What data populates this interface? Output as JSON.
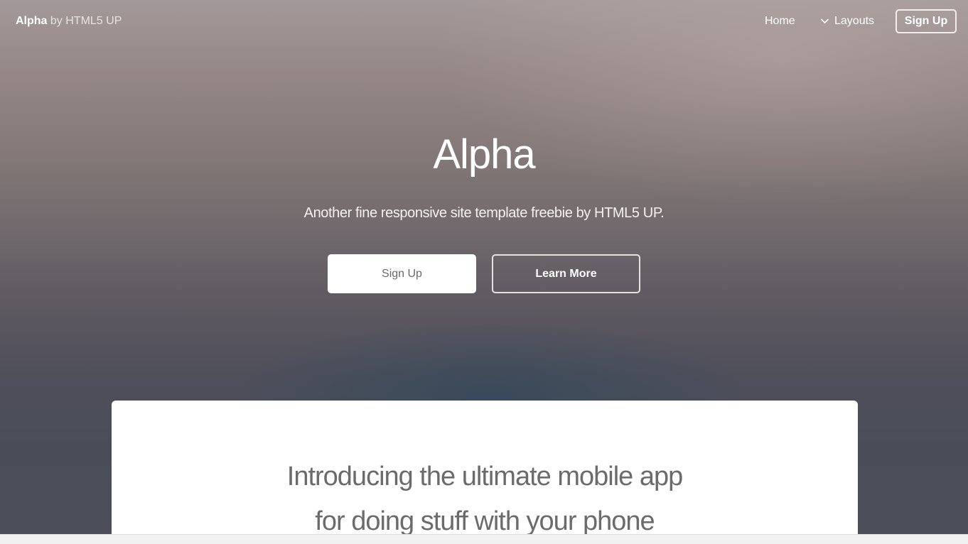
{
  "header": {
    "brand_name": "Alpha",
    "brand_suffix": "by HTML5 UP",
    "nav": {
      "home": "Home",
      "layouts": "Layouts",
      "signup": "Sign Up"
    }
  },
  "hero": {
    "title": "Alpha",
    "subtitle": "Another fine responsive site template freebie by HTML5 UP.",
    "primary_button": "Sign Up",
    "secondary_button": "Learn More"
  },
  "intro": {
    "line1": "Introducing the ultimate mobile app",
    "line2": "for doing stuff with your phone"
  },
  "icons": {
    "layouts_dropdown": "chevron-down-icon"
  },
  "colors": {
    "text_light": "#ffffff",
    "card_text": "#6b6b6b",
    "card_bg": "#ffffff"
  }
}
